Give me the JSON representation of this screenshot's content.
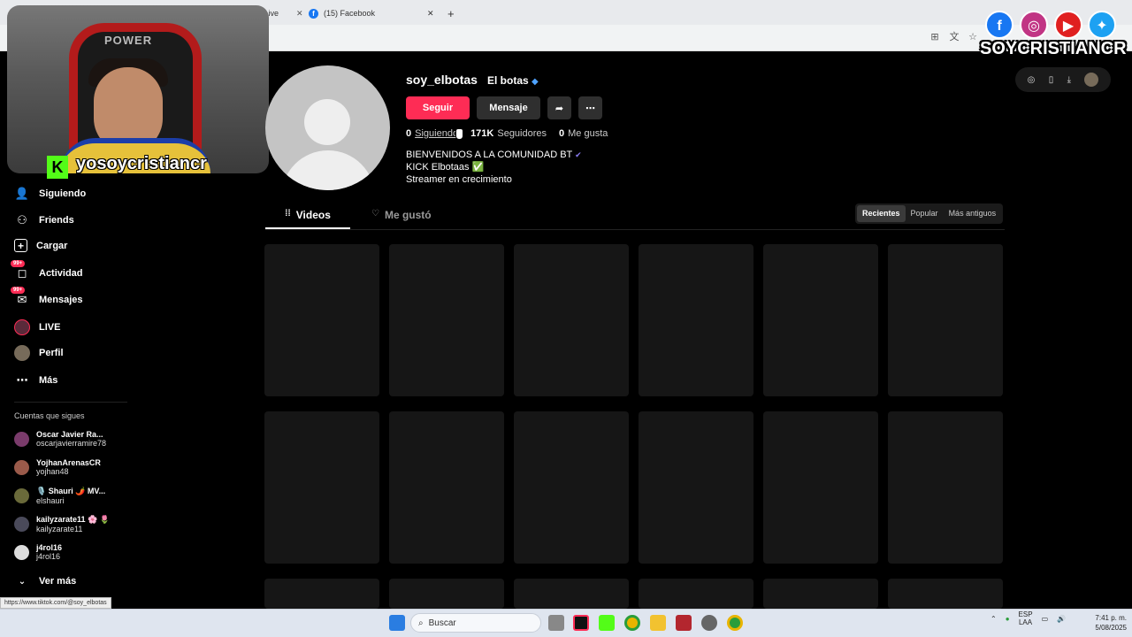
{
  "browser": {
    "tab1_partial": "tch Live",
    "tab2_title": "(15) Facebook",
    "new_tab": "+"
  },
  "overlay": {
    "chair_logo": "POWER",
    "kick_letter": "K",
    "kick_user": "yosoycristiancr",
    "social_handle": "SOYCRISTIANCR",
    "social_icons": [
      "facebook-icon",
      "instagram-icon",
      "youtube-icon",
      "twitter-icon"
    ]
  },
  "sidebar": {
    "items": [
      {
        "label": "Siguiendo",
        "icon": "following-icon"
      },
      {
        "label": "Friends",
        "icon": "friends-icon"
      },
      {
        "label": "Cargar",
        "icon": "upload-icon"
      },
      {
        "label": "Actividad",
        "icon": "activity-icon",
        "badge": "99+"
      },
      {
        "label": "Mensajes",
        "icon": "messages-icon",
        "badge": "99+"
      },
      {
        "label": "LIVE",
        "icon": "live-icon"
      },
      {
        "label": "Perfil",
        "icon": "profile-icon"
      },
      {
        "label": "Más",
        "icon": "more-icon"
      }
    ],
    "following_title": "Cuentas que sigues",
    "accounts": [
      {
        "name": "Oscar Javier Ra...",
        "handle": "oscarjavierramire78"
      },
      {
        "name": "YojhanArenasCR",
        "handle": "yojhan48"
      },
      {
        "name": "🎙️ Shauri 🌶️ MV...",
        "handle": "elshauri"
      },
      {
        "name": "kailyzarate11 🌸 🌷",
        "handle": "kailyzarate11"
      },
      {
        "name": "j4rol16",
        "handle": "j4rol16"
      }
    ],
    "see_more": "Ver más"
  },
  "profile": {
    "username": "soy_elbotas",
    "nickname": "El botas",
    "follow_btn": "Seguir",
    "message_btn": "Mensaje",
    "following_count": "0",
    "following_label": "Siguiendo",
    "followers_count": "171K",
    "followers_label": "Seguidores",
    "likes_count": "0",
    "likes_label": "Me gusta",
    "bio": [
      "BIENVENIDOS A LA COMUNIDAD BT",
      "KICK Elbotaas ✅",
      "Streamer en crecimiento"
    ]
  },
  "tabs": {
    "videos": "Videos",
    "liked": "Me gustó"
  },
  "sort": {
    "options": [
      "Recientes",
      "Popular",
      "Más antiguos"
    ],
    "selected": "Recientes"
  },
  "status_link": "https://www.tiktok.com/@soy_elbotas",
  "taskbar": {
    "search": "Buscar",
    "lang1": "ESP",
    "lang2": "LAA",
    "time": "7:41 p. m.",
    "date": "5/08/2025"
  },
  "colors": {
    "accent": "#fe2c55",
    "tile": "#161616",
    "kick": "#53fc18"
  }
}
